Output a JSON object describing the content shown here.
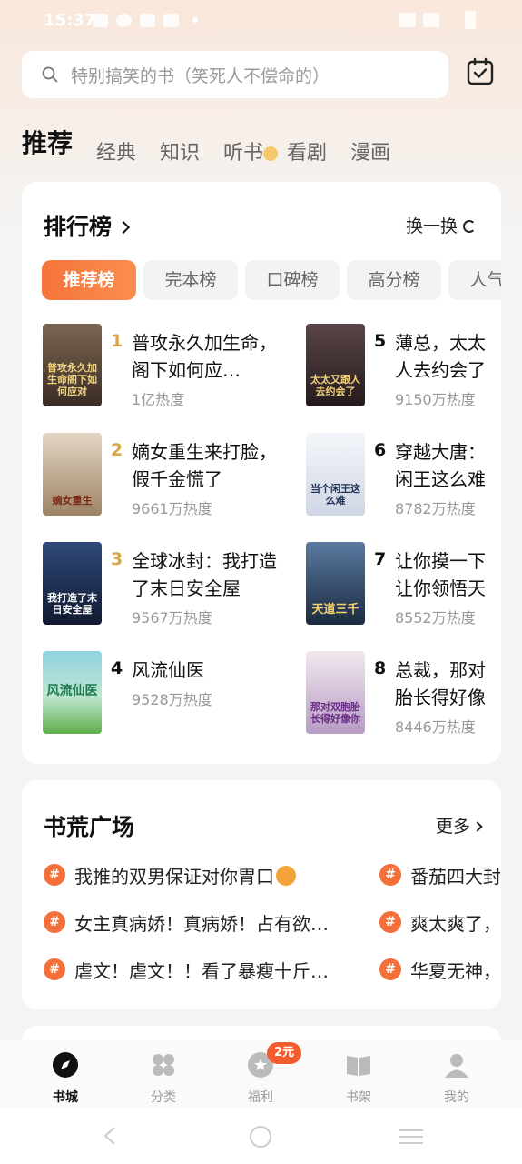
{
  "status_bar": {
    "time": "15:37"
  },
  "search": {
    "placeholder": "特别搞笑的书（笑死人不偿命的）"
  },
  "tabs": [
    "推荐",
    "经典",
    "知识",
    "听书",
    "看剧",
    "漫画"
  ],
  "ranking": {
    "title": "排行榜",
    "refresh_label": "换一换",
    "chips": [
      "推荐榜",
      "完本榜",
      "口碑榜",
      "高分榜",
      "人气榜"
    ],
    "books": [
      {
        "rank": "1",
        "title": "普攻永久加生命，阁下如何应…",
        "heat": "1亿热度",
        "cover_text": "普攻永久加生命阁下如何应对",
        "cover_color": "#5a4a3e"
      },
      {
        "rank": "2",
        "title": "嫡女重生来打脸，假千金慌了",
        "heat": "9661万热度",
        "cover_text": "嫡女重生",
        "cover_color": "#cdbfa7"
      },
      {
        "rank": "3",
        "title": "全球冰封：我打造了末日安全屋",
        "heat": "9567万热度",
        "cover_text": "我打造了末日安全屋",
        "cover_color": "#1f2f52"
      },
      {
        "rank": "4",
        "title": "风流仙医",
        "heat": "9528万热度",
        "cover_text": "风流仙医",
        "cover_color": "#7fc8d6"
      },
      {
        "rank": "5",
        "title": "薄总，太太人去约会了",
        "heat": "9150万热度",
        "cover_text": "太太又跟人去约会了",
        "cover_color": "#3b2f33"
      },
      {
        "rank": "6",
        "title": "穿越大唐：闲王这么难",
        "heat": "8782万热度",
        "cover_text": "当个闲王这么难",
        "cover_color": "#e9ecf2"
      },
      {
        "rank": "7",
        "title": "让你摸一下让你领悟天",
        "heat": "8552万热度",
        "cover_text": "天道三千",
        "cover_color": "#33475f"
      },
      {
        "rank": "8",
        "title": "总裁，那对胎长得好像",
        "heat": "8446万热度",
        "cover_text": "那对双胞胎长得好像你",
        "cover_color": "#e6dbe8"
      }
    ]
  },
  "topics": {
    "title": "书荒广场",
    "more_label": "更多",
    "hash_symbol": "#",
    "items": [
      "我推的双男保证对你胃口",
      "番茄四大封",
      "女主真病娇！真病娇！占有欲…",
      "爽太爽了，",
      "虐文！虐文！！看了暴瘦十斤…",
      "华夏无神，"
    ]
  },
  "bottom_nav": {
    "items": [
      "书城",
      "分类",
      "福利",
      "书架",
      "我的"
    ],
    "welfare_badge": "2元"
  },
  "colors": {
    "accent": "#f4703a",
    "rank_gold": "#d6a74e"
  }
}
